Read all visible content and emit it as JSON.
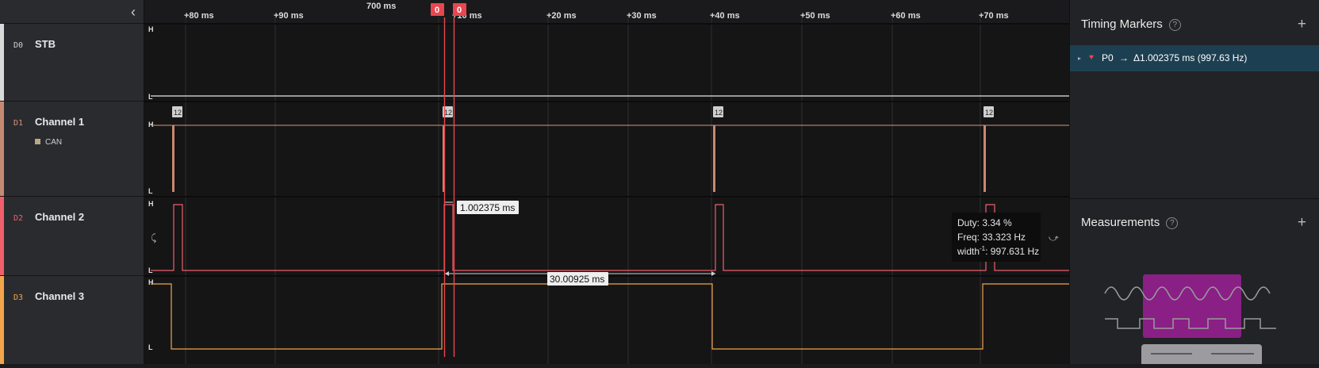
{
  "left_panel": {
    "channels": [
      {
        "tag": "D0",
        "name": "STB",
        "color": "#d9d9d9"
      },
      {
        "tag": "D1",
        "name": "Channel 1",
        "color": "#d9957a",
        "analyzer": "CAN"
      },
      {
        "tag": "D2",
        "name": "Channel 2",
        "color": "#ef5f6c"
      },
      {
        "tag": "D3",
        "name": "Channel 3",
        "color": "#f2a54a"
      }
    ]
  },
  "timeline": {
    "ticks": [
      "+80 ms",
      "+90 ms",
      "700 ms",
      "+10 ms",
      "+20 ms",
      "+30 ms",
      "+40 ms",
      "+50 ms",
      "+60 ms",
      "+70 ms"
    ],
    "marker_labels": [
      "0",
      "0"
    ],
    "level_high": "H",
    "level_low": "L",
    "can_badge": "12",
    "width_measure": "1.002375 ms",
    "period_measure": "30.00925 ms",
    "tooltip": {
      "duty": "Duty: 3.34 %",
      "freq": "Freq: 33.323 Hz",
      "width_label": "width",
      "width_sup": "-1",
      "width_value": ": 997.631 Hz"
    }
  },
  "right_panel": {
    "timing_title": "Timing Markers",
    "help": "?",
    "add": "+",
    "marker": {
      "name": "P0",
      "arrow": "→",
      "value": "Δ1.002375 ms (997.63 Hz)"
    },
    "measurements_title": "Measurements"
  },
  "colors": {
    "marker": "#e8474f",
    "accent_selected": "#1d3f52",
    "measure_highlight": "#8a1f86"
  }
}
